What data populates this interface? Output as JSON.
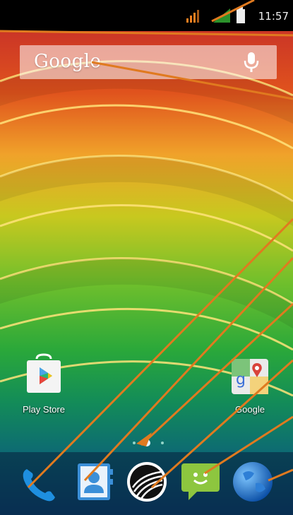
{
  "status_bar": {
    "time": "11:57"
  },
  "search": {
    "wordmark": "Google"
  },
  "home_apps": [
    {
      "label": "Play Store"
    },
    {
      "label": "Google"
    }
  ],
  "dock": {
    "icons": [
      "phone-icon",
      "contacts-icon",
      "launcher-icon",
      "messaging-icon",
      "browser-icon"
    ]
  },
  "colors": {
    "annotation": "#e07a1f",
    "status_bar": "#000000"
  }
}
